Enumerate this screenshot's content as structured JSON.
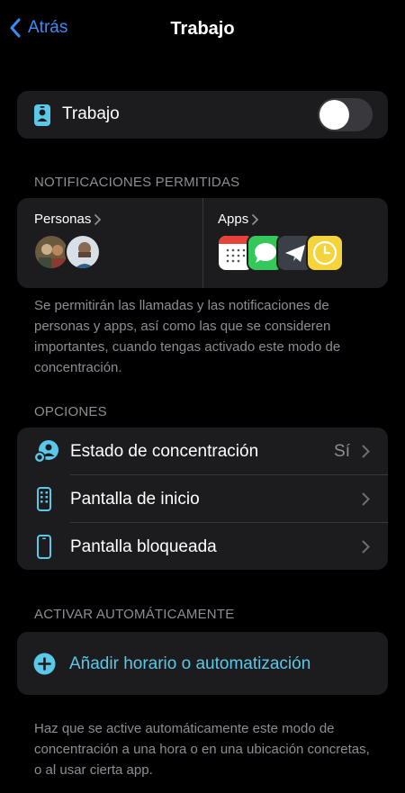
{
  "nav": {
    "back_label": "Atrás",
    "title": "Trabajo"
  },
  "focus_toggle": {
    "label": "Trabajo",
    "enabled": false
  },
  "notifications": {
    "header": "NOTIFICACIONES PERMITIDAS",
    "people_label": "Personas",
    "apps_label": "Apps",
    "people": [
      "person-1",
      "person-2"
    ],
    "apps": [
      "calendar-app-icon",
      "messages-app-icon",
      "telegram-app-icon",
      "clock-app-icon"
    ],
    "footnote": "Se permitirán las llamadas y las notificaciones de personas y apps, así como las que se consideren importantes, cuando tengas activado este modo de concentración."
  },
  "options": {
    "header": "OPCIONES",
    "rows": [
      {
        "label": "Estado de concentración",
        "value": "Sí",
        "icon": "focus-status-icon"
      },
      {
        "label": "Pantalla de inicio",
        "value": "",
        "icon": "home-screen-icon"
      },
      {
        "label": "Pantalla bloqueada",
        "value": "",
        "icon": "lock-screen-icon"
      }
    ]
  },
  "auto": {
    "header": "ACTIVAR AUTOMÁTICAMENTE",
    "add_label": "Añadir horario o automatización",
    "footnote": "Haz que se active automáticamente este modo de concentración a una hora o en una ubicación concretas, o al usar cierta app."
  },
  "colors": {
    "accent_blue": "#3a8bf5",
    "accent_teal": "#5ac8e8",
    "background": "#000000",
    "card": "#1c1c1e",
    "secondary_text": "#8d8d93"
  }
}
